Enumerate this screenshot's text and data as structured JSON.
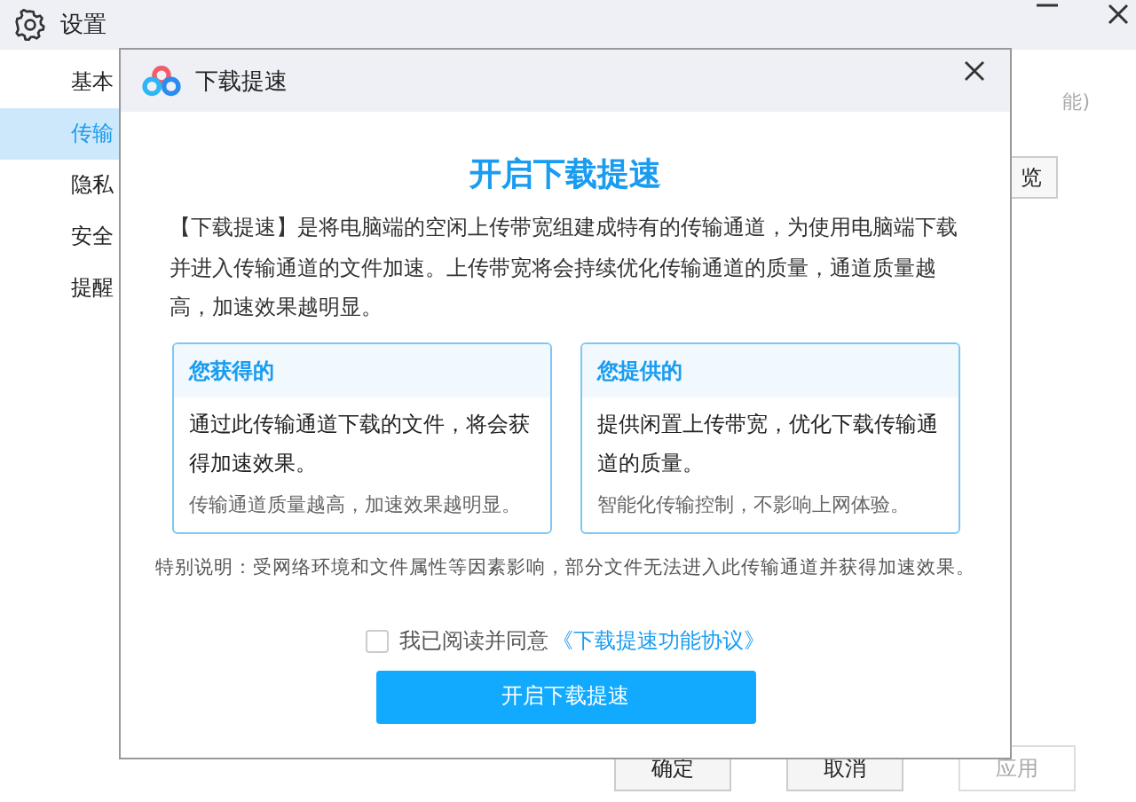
{
  "window": {
    "title": "设置"
  },
  "sidebar": {
    "items": [
      {
        "label": "基本",
        "selected": false
      },
      {
        "label": "传输",
        "selected": true
      },
      {
        "label": "隐私",
        "selected": false
      },
      {
        "label": "安全",
        "selected": false
      },
      {
        "label": "提醒",
        "selected": false
      }
    ]
  },
  "background_content": {
    "note_fragment": "能)",
    "button_fragment": "览"
  },
  "footer_buttons": [
    {
      "label": "确定",
      "disabled": false
    },
    {
      "label": "取消",
      "disabled": false
    },
    {
      "label": "应用",
      "disabled": true
    }
  ],
  "dialog": {
    "title": "下载提速",
    "heading": "开启下载提速",
    "description": "【下载提速】是将电脑端的空闲上传带宽组建成特有的传输通道，为使用电脑端下载并进入传输通道的文件加速。上传带宽将会持续优化传输通道的质量，通道质量越高，加速效果越明显。",
    "cards": [
      {
        "title": "您获得的",
        "body": "通过此传输通道下载的文件，将会获得加速效果。",
        "note": "传输通道质量越高，加速效果越明显。"
      },
      {
        "title": "您提供的",
        "body": "提供闲置上传带宽，优化下载传输通道的质量。",
        "note": "智能化传输控制，不影响上网体验。"
      }
    ],
    "special_note": "特别说明：受网络环境和文件属性等因素影响，部分文件无法进入此传输通道并获得加速效果。",
    "agreement": {
      "checked": false,
      "text": "我已阅读并同意",
      "link": "《下载提速功能协议》"
    },
    "primary_button": "开启下载提速"
  }
}
